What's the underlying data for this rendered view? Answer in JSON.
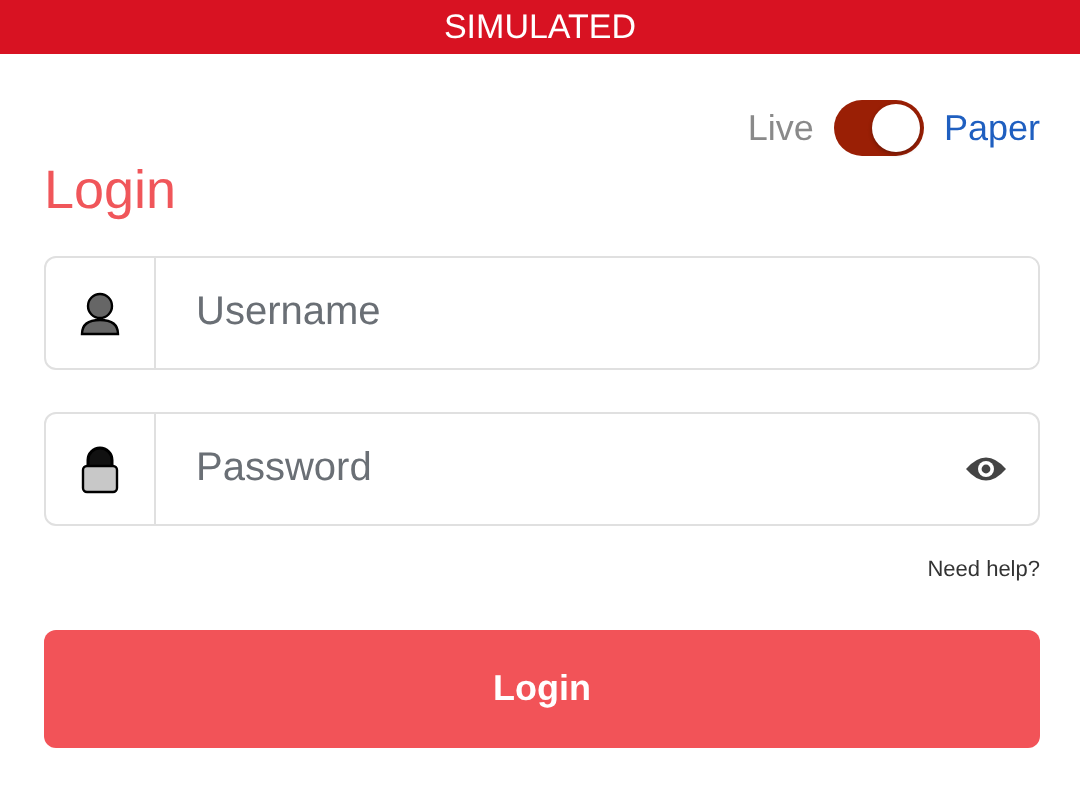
{
  "banner": {
    "text": "SIMULATED"
  },
  "mode_toggle": {
    "left_label": "Live",
    "right_label": "Paper",
    "on": true
  },
  "title": "Login",
  "fields": [
    {
      "kind": "user",
      "placeholder": "Username"
    },
    {
      "kind": "password",
      "placeholder": "Password"
    }
  ],
  "help_link": "Need help?",
  "login_button": "Login"
}
